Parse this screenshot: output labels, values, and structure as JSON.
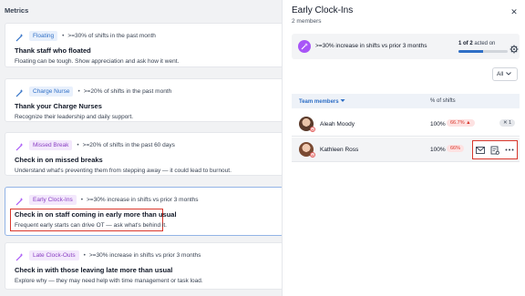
{
  "left": {
    "title": "Metrics",
    "cards": [
      {
        "tag": "Floating",
        "metric": ">=30% of shifts in the past month",
        "title": "Thank staff who floated",
        "desc": "Floating can be tough. Show appreciation and ask how it went."
      },
      {
        "tag": "Charge Nurse",
        "metric": ">=20% of shifts in the past month",
        "title": "Thank your Charge Nurses",
        "desc": "Recognize their leadership and daily support."
      },
      {
        "tag": "Missed Break",
        "metric": ">=20% of shifts in the past 60 days",
        "title": "Check in on missed breaks",
        "desc": "Understand what's preventing them from stepping away — it could lead to burnout."
      },
      {
        "tag": "Early Clock-Ins",
        "metric": ">=30% increase in shifts vs prior 3 months",
        "title": "Check in on staff coming in early more than usual",
        "desc": "Frequent early starts can drive OT — ask what's behind it."
      },
      {
        "tag": "Late Clock-Outs",
        "metric": ">=30% increase in shifts vs prior 3 months",
        "title": "Check in with those leaving late more than usual",
        "desc": "Explore why — they may need help with time management or task load."
      }
    ],
    "separator": "•"
  },
  "drawer": {
    "title": "Early Clock-Ins",
    "subtitle": "2 members",
    "close_icon": "close-icon",
    "summary_text": ">=30% increase in shifts vs prior 3 months",
    "acted_count": "1 of 2",
    "acted_suffix": "acted on",
    "acted_fraction": 0.5,
    "filter_value": "All",
    "col_members": "Team members",
    "col_shifts": "% of shifts",
    "rows": [
      {
        "name": "Aleah Moody",
        "pct": "100%",
        "delta": "66.7% ▲",
        "count": "1"
      },
      {
        "name": "Kathleen Ross",
        "pct": "100%",
        "delta": "66%"
      }
    ],
    "avatar_badge": "H"
  },
  "colors": {
    "accent": "#2f6fc6",
    "alert": "#d9362b",
    "purple": "#a855f7"
  }
}
